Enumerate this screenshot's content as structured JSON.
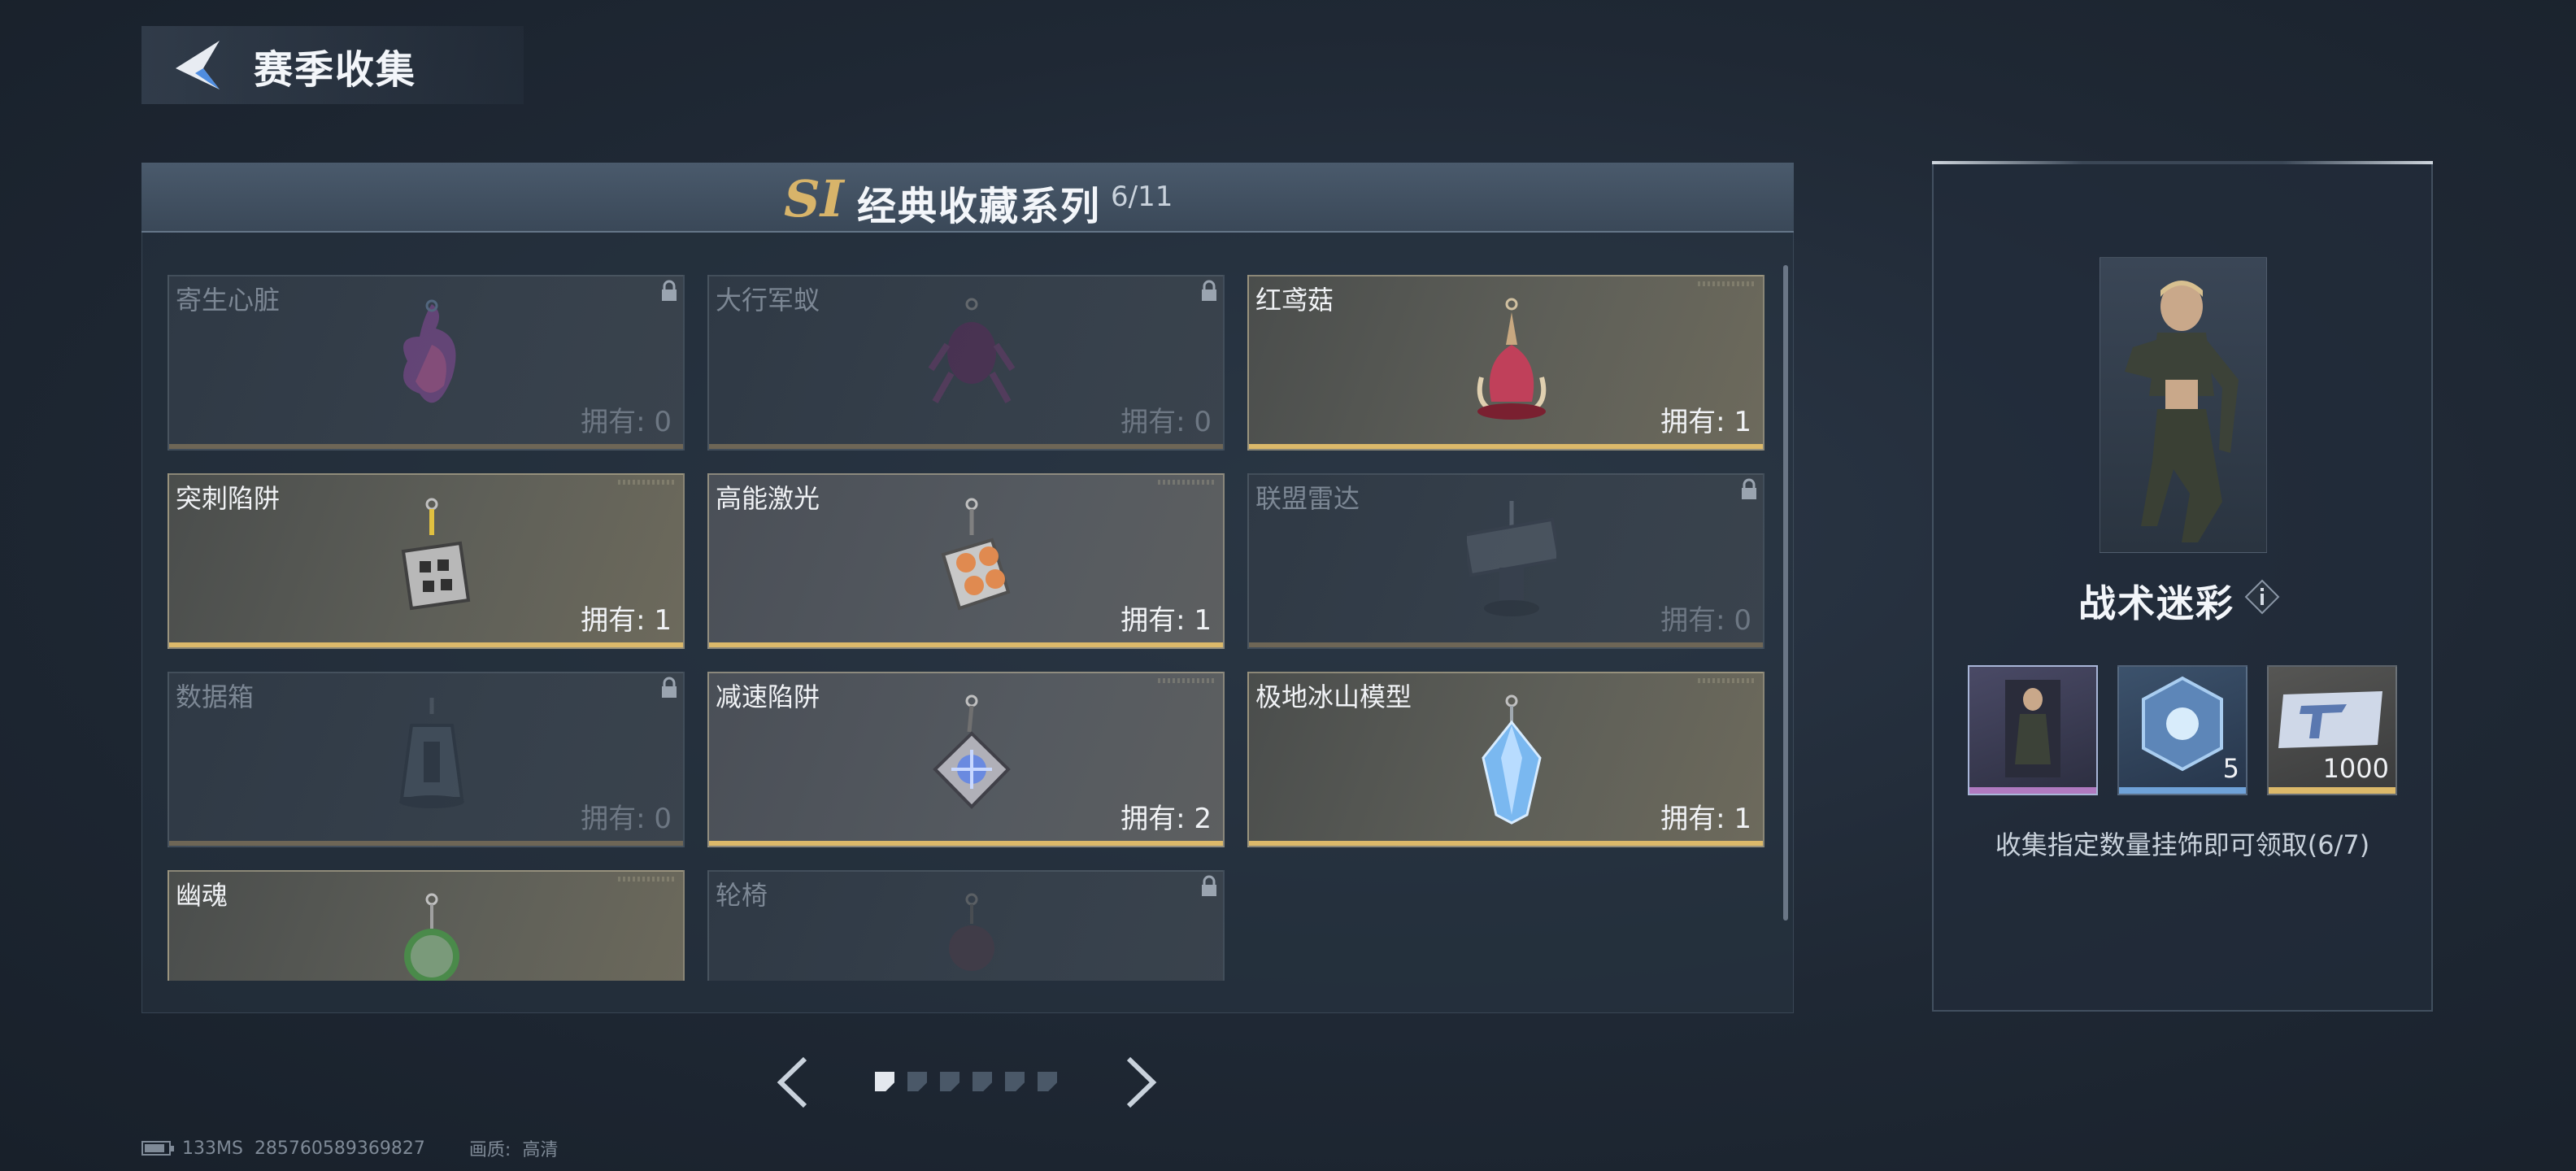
{
  "header": {
    "title": "赛季收集"
  },
  "series": {
    "badge": "SI",
    "title": "经典收藏系列",
    "progress": "6/11"
  },
  "collection_items": [
    {
      "name": "寄生心脏",
      "owned_label": "拥有: 0",
      "state": "locked",
      "icon": "parasite-heart-charm-icon"
    },
    {
      "name": "大行军蚁",
      "owned_label": "拥有: 0",
      "state": "locked",
      "icon": "army-ant-charm-icon"
    },
    {
      "name": "红鸢菇",
      "owned_label": "拥有: 1",
      "state": "owned",
      "icon": "red-mushroom-charm-icon"
    },
    {
      "name": "突刺陷阱",
      "owned_label": "拥有: 1",
      "state": "owned",
      "icon": "spike-trap-charm-icon"
    },
    {
      "name": "高能激光",
      "owned_label": "拥有: 1",
      "state": "owned",
      "icon": "laser-charm-icon"
    },
    {
      "name": "联盟雷达",
      "owned_label": "拥有: 0",
      "state": "locked",
      "icon": "alliance-radar-charm-icon"
    },
    {
      "name": "数据箱",
      "owned_label": "拥有: 0",
      "state": "locked",
      "icon": "data-box-charm-icon"
    },
    {
      "name": "减速陷阱",
      "owned_label": "拥有: 2",
      "state": "owned",
      "icon": "slow-trap-charm-icon"
    },
    {
      "name": "极地冰山模型",
      "owned_label": "拥有: 1",
      "state": "owned",
      "icon": "iceberg-charm-icon"
    },
    {
      "name": "幽魂",
      "owned_label": "",
      "state": "owned",
      "icon": "ghost-charm-icon"
    },
    {
      "name": "轮椅",
      "owned_label": "",
      "state": "locked",
      "icon": "wheelchair-charm-icon"
    }
  ],
  "pagination": {
    "pages": 6,
    "current": 1
  },
  "reward": {
    "name": "战术迷彩",
    "items": [
      {
        "icon": "tactical-camo-skin-icon",
        "qty": ""
      },
      {
        "icon": "crystal-crate-icon",
        "qty": "5"
      },
      {
        "icon": "currency-ticket-icon",
        "qty": "1000"
      }
    ],
    "hint": "收集指定数量挂饰即可领取(6/7)"
  },
  "status": {
    "ping": "133MS",
    "uid": "285760589369827",
    "quality_label": "画质:",
    "quality_value": "高清"
  },
  "colors": {
    "accent_gold": "#dcb96a",
    "locked_bar": "#6e6656",
    "panel_bg": "#2c3848"
  }
}
